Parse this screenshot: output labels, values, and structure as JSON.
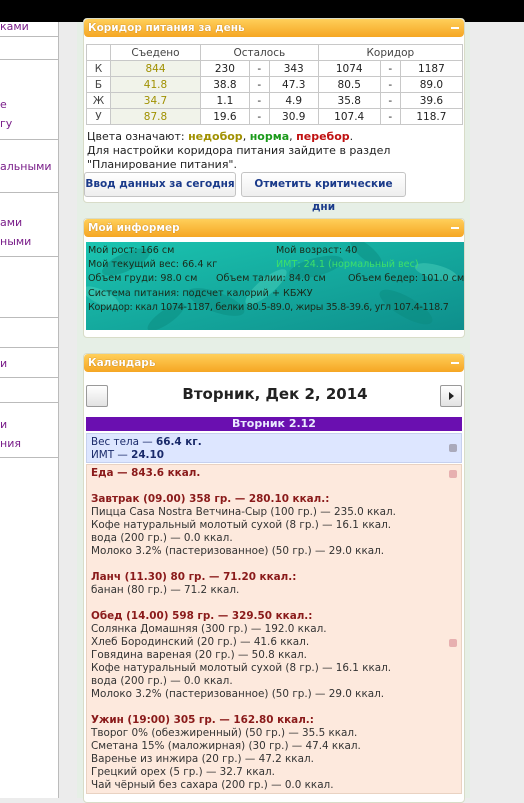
{
  "sidebar": {
    "links": [
      "ками",
      "е",
      "гу",
      "альными",
      "ами",
      "ными",
      "и",
      "и",
      "ния"
    ]
  },
  "corridor": {
    "title": "Коридор питания за день",
    "headers": [
      "Съедено",
      "Осталось",
      "Коридор"
    ],
    "rows": [
      {
        "label": "К",
        "eaten": "844",
        "left_min": "230",
        "left_max": "343",
        "corr_min": "1074",
        "corr_max": "1187"
      },
      {
        "label": "Б",
        "eaten": "41.8",
        "left_min": "38.8",
        "left_max": "47.3",
        "corr_min": "80.5",
        "corr_max": "89.0"
      },
      {
        "label": "Ж",
        "eaten": "34.7",
        "left_min": "1.1",
        "left_max": "4.9",
        "corr_min": "35.8",
        "corr_max": "39.6"
      },
      {
        "label": "У",
        "eaten": "87.8",
        "left_min": "19.6",
        "left_max": "30.9",
        "corr_min": "107.4",
        "corr_max": "118.7"
      }
    ],
    "dash": "-",
    "legend_prefix": "Цвета означают:",
    "legend_under": "недобор",
    "legend_norm": "норма",
    "legend_over": "перебор",
    "note": "Для настройки коридора питания зайдите в раздел",
    "note2": "\"Планирование питания\".",
    "btn_today": "Ввод данных за сегодня",
    "btn_critical": "Отметить критические дни",
    "colors": {
      "under": "#a09000",
      "norm": "#1a9a1a",
      "over": "#c01010"
    }
  },
  "informer": {
    "title": "Мой информер",
    "height": "Мой рост: 166 см",
    "age": "Мой возраст: 40",
    "weight": "Мой текущий вес: 66.4 кг",
    "bmi": "ИМТ: 24.1 (нормальный вес)",
    "chest": "Объем груди: 98.0 см",
    "waist": "Объем талии: 84.0 см",
    "hips": "Объем бедер: 101.0 см",
    "system": "Система питания: подсчет калорий + КБЖУ",
    "corridor": "Коридор: ккал 1074-1187, белки 80.5-89.0, жиры 35.8-39.6, угл 107.4-118.7"
  },
  "calendar": {
    "title": "Календарь",
    "date": "Вторник, Дек 2, 2014",
    "day_label": "Вторник 2.12",
    "weight_label": "Вес тела — ",
    "weight_value": "66.4 кг.",
    "bmi_label": "ИМТ — ",
    "bmi_value": "24.10",
    "food_label": "Еда — ",
    "food_value": "843.6 ккал.",
    "meals": [
      {
        "header": "Завтрак (09.00) 358 гр. — 280.10 ккал.:",
        "items": [
          "Пицца Casa Nostra Ветчина-Сыр (100 гр.) — 235.0 ккал.",
          "Кофе натуральный молотый сухой (8 гр.) — 16.1 ккал.",
          "вода (200 гр.) — 0.0 ккал.",
          "Молоко 3.2% (пастеризованное) (50 гр.) — 29.0 ккал."
        ]
      },
      {
        "header": "Ланч (11.30) 80 гр. — 71.20 ккал.:",
        "items": [
          "банан (80 гр.) — 71.2 ккал."
        ]
      },
      {
        "header": "Обед (14.00) 598 гр. — 329.50 ккал.:",
        "items": [
          "Солянка Домашняя (300 гр.) — 192.0 ккал.",
          "Хлеб Бородинский (20 гр.) — 41.6 ккал.",
          "Говядина вареная (20 гр.) — 50.8 ккал.",
          "Кофе натуральный молотый сухой (8 гр.) — 16.1 ккал.",
          "вода (200 гр.) — 0.0 ккал.",
          "Молоко 3.2% (пастеризованное) (50 гр.) — 29.0 ккал."
        ]
      },
      {
        "header": "Ужин (19:00) 305 гр. — 162.80 ккал.:",
        "items": [
          "Творог 0% (обезжиренный) (50 гр.) — 35.5 ккал.",
          "Сметана 15% (маложирная) (30 гр.) — 47.4 ккал.",
          "Варенье из инжира (20 гр.) — 47.2 ккал.",
          "Грецкий орех (5 гр.) — 32.7 ккал.",
          "Чай чёрный без сахара (200 гр.) — 0.0 ккал."
        ]
      }
    ],
    "icons": {
      "prev": "prev-arrow-icon",
      "next": "next-arrow-icon"
    }
  }
}
